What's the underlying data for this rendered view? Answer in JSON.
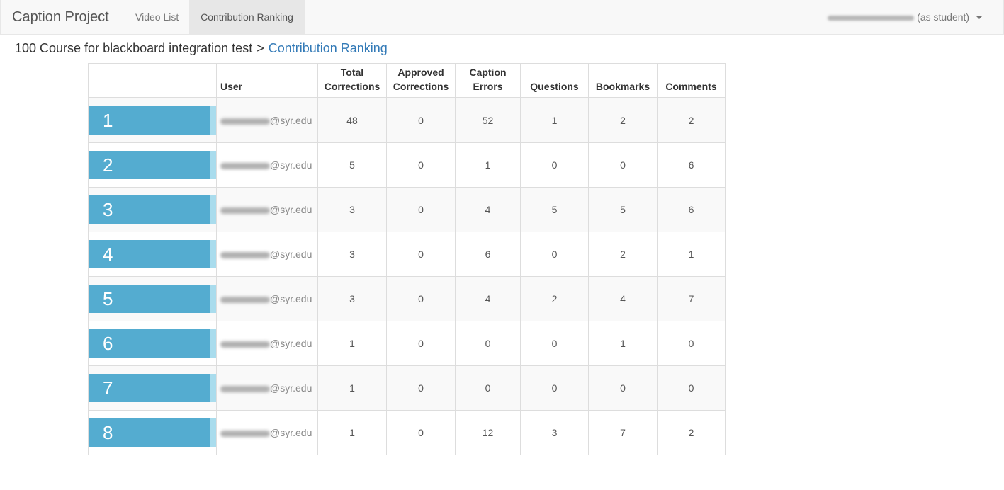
{
  "navbar": {
    "brand": "Caption Project",
    "links": [
      {
        "label": "Video List"
      },
      {
        "label": "Contribution Ranking"
      }
    ],
    "user_suffix": "(as student)"
  },
  "breadcrumb": {
    "course": "100 Course for blackboard integration test",
    "separator": ">",
    "current": "Contribution Ranking"
  },
  "table": {
    "headers": {
      "rank": "",
      "user": "User",
      "total_corrections": "Total Corrections",
      "approved_corrections": "Approved Corrections",
      "caption_errors": "Caption Errors",
      "questions": "Questions",
      "bookmarks": "Bookmarks",
      "comments": "Comments"
    },
    "rows": [
      {
        "rank": "1",
        "user": "@syr.edu",
        "total": "48",
        "approved": "0",
        "errors": "52",
        "questions": "1",
        "bookmarks": "2",
        "comments": "2"
      },
      {
        "rank": "2",
        "user": "@syr.edu",
        "total": "5",
        "approved": "0",
        "errors": "1",
        "questions": "0",
        "bookmarks": "0",
        "comments": "6"
      },
      {
        "rank": "3",
        "user": "@syr.edu",
        "total": "3",
        "approved": "0",
        "errors": "4",
        "questions": "5",
        "bookmarks": "5",
        "comments": "6"
      },
      {
        "rank": "4",
        "user": "@syr.edu",
        "total": "3",
        "approved": "0",
        "errors": "6",
        "questions": "0",
        "bookmarks": "2",
        "comments": "1"
      },
      {
        "rank": "5",
        "user": "@syr.edu",
        "total": "3",
        "approved": "0",
        "errors": "4",
        "questions": "2",
        "bookmarks": "4",
        "comments": "7"
      },
      {
        "rank": "6",
        "user": "@syr.edu",
        "total": "1",
        "approved": "0",
        "errors": "0",
        "questions": "0",
        "bookmarks": "1",
        "comments": "0"
      },
      {
        "rank": "7",
        "user": "@syr.edu",
        "total": "1",
        "approved": "0",
        "errors": "0",
        "questions": "0",
        "bookmarks": "0",
        "comments": "0"
      },
      {
        "rank": "8",
        "user": "@syr.edu",
        "total": "1",
        "approved": "0",
        "errors": "12",
        "questions": "3",
        "bookmarks": "7",
        "comments": "2"
      }
    ]
  },
  "colors": {
    "rank_bar": "#54acd0",
    "rank_bar_tail": "#a9dced",
    "link": "#337ab7"
  }
}
